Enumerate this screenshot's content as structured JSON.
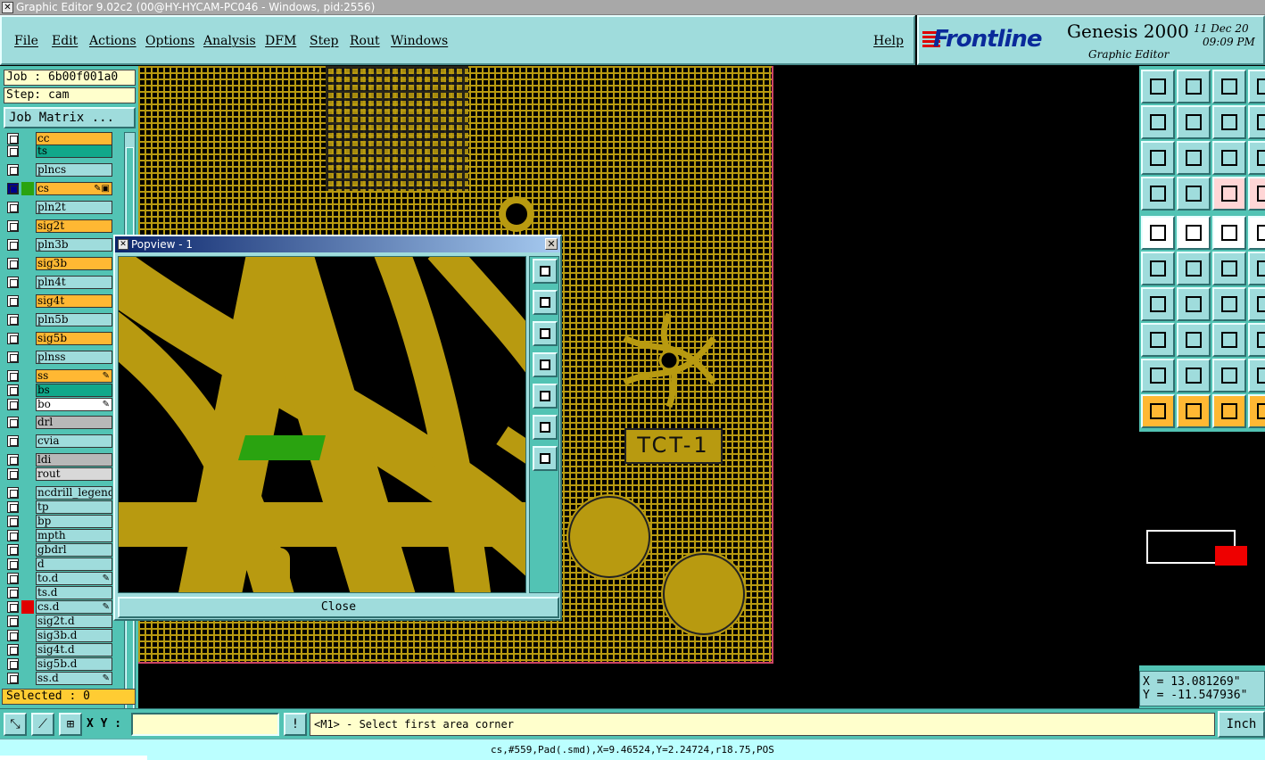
{
  "window": {
    "title": "Graphic Editor 9.02c2 (00@HY-HYCAM-PC046 - Windows, pid:2556)"
  },
  "menu": [
    "File",
    "Edit",
    "Actions",
    "Options",
    "Analysis",
    "DFM",
    "Step",
    "Rout",
    "Windows",
    "Help"
  ],
  "logo": {
    "brand": "Frontline",
    "product": "Genesis 2000",
    "sub": "Graphic Editor",
    "date": "11 Dec 20",
    "time": "09:09 PM"
  },
  "job": {
    "job_line": "Job : 6b00f001a0",
    "step_line": "Step: cam",
    "matrix_button": "Job Matrix ..."
  },
  "layers": [
    {
      "name": "cc",
      "color": "#ffb833"
    },
    {
      "name": "ts",
      "color": "#11a88a"
    },
    {
      "name": "plncs",
      "color": "#9fdcdc"
    },
    {
      "name": "cs",
      "color": "#ffb833",
      "flag": "✎▣",
      "active": true
    },
    {
      "name": "pln2t",
      "color": "#9fdcdc"
    },
    {
      "name": "sig2t",
      "color": "#ffb833"
    },
    {
      "name": "pln3b",
      "color": "#9fdcdc"
    },
    {
      "name": "sig3b",
      "color": "#ffb833"
    },
    {
      "name": "pln4t",
      "color": "#9fdcdc"
    },
    {
      "name": "sig4t",
      "color": "#ffb833"
    },
    {
      "name": "pln5b",
      "color": "#9fdcdc"
    },
    {
      "name": "sig5b",
      "color": "#ffb833"
    },
    {
      "name": "plnss",
      "color": "#9fdcdc"
    },
    {
      "name": "ss",
      "color": "#ffb833",
      "flag": "✎"
    },
    {
      "name": "bs",
      "color": "#11a88a"
    },
    {
      "name": "bo",
      "color": "#ffffff",
      "flag": "✎"
    },
    {
      "name": "drl",
      "color": "#b8b8b8"
    },
    {
      "name": "cvia",
      "color": "#9fdcdc"
    },
    {
      "name": "ldi",
      "color": "#b8b8b8"
    },
    {
      "name": "rout",
      "color": "#d8d8d8"
    },
    {
      "name": "ncdrill_legend",
      "color": "#9fdcdc"
    },
    {
      "name": "tp",
      "color": "#9fdcdc"
    },
    {
      "name": "bp",
      "color": "#9fdcdc"
    },
    {
      "name": "mpth",
      "color": "#9fdcdc"
    },
    {
      "name": "gbdrl",
      "color": "#9fdcdc"
    },
    {
      "name": "d",
      "color": "#9fdcdc"
    },
    {
      "name": "to.d",
      "color": "#9fdcdc",
      "flag": "✎"
    },
    {
      "name": "ts.d",
      "color": "#9fdcdc"
    },
    {
      "name": "cs.d",
      "color": "#9fdcdc",
      "flag": "✎",
      "marker": "#e00000"
    },
    {
      "name": "sig2t.d",
      "color": "#9fdcdc"
    },
    {
      "name": "sig3b.d",
      "color": "#9fdcdc"
    },
    {
      "name": "sig4t.d",
      "color": "#9fdcdc"
    },
    {
      "name": "sig5b.d",
      "color": "#9fdcdc"
    },
    {
      "name": "ss.d",
      "color": "#9fdcdc",
      "flag": "✎"
    }
  ],
  "selected": "Selected : 0",
  "board": {
    "label": "TCT-1"
  },
  "popview": {
    "title": "Popview - 1",
    "close_label": "Close"
  },
  "coords": {
    "x": "X = 13.081269\"",
    "y": "Y = -11.547936\""
  },
  "bottom": {
    "xy_label": "X Y :",
    "xy_value": "",
    "prompt": "<M1> - Select first area corner",
    "unit": "Inch",
    "status": "cs,#559,Pad(.smd),X=9.46524,Y=2.24724,r18.75,POS"
  }
}
